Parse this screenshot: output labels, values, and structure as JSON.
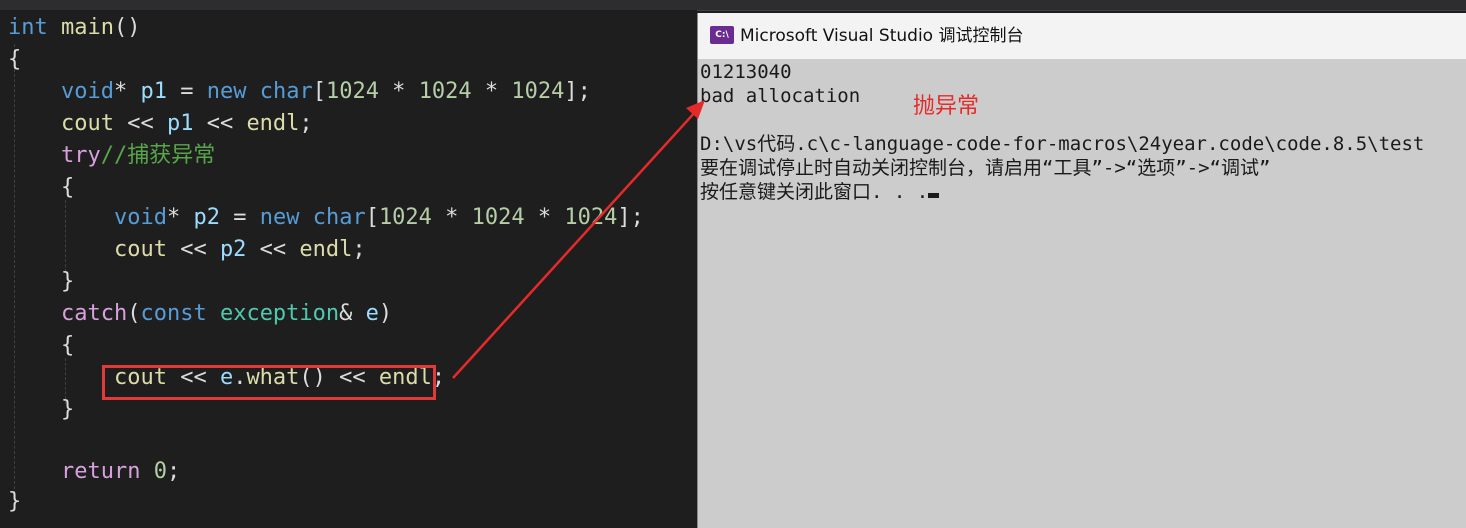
{
  "editor": {
    "lines": [
      [
        [
          "kw",
          "int"
        ],
        [
          "pl",
          " "
        ],
        [
          "fn",
          "main"
        ],
        [
          "pl",
          "()"
        ]
      ],
      [
        [
          "pl",
          "{"
        ]
      ],
      [
        [
          "pl",
          "    "
        ],
        [
          "kw",
          "void"
        ],
        [
          "pl",
          "* "
        ],
        [
          "var",
          "p1"
        ],
        [
          "pl",
          " = "
        ],
        [
          "kw",
          "new"
        ],
        [
          "pl",
          " "
        ],
        [
          "kw",
          "char"
        ],
        [
          "pl",
          "["
        ],
        [
          "num",
          "1024"
        ],
        [
          "pl",
          " * "
        ],
        [
          "num",
          "1024"
        ],
        [
          "pl",
          " * "
        ],
        [
          "num",
          "1024"
        ],
        [
          "pl",
          "];"
        ]
      ],
      [
        [
          "pl",
          "    "
        ],
        [
          "fn",
          "cout"
        ],
        [
          "pl",
          " << "
        ],
        [
          "var",
          "p1"
        ],
        [
          "pl",
          " << "
        ],
        [
          "fn",
          "endl"
        ],
        [
          "pl",
          ";"
        ]
      ],
      [
        [
          "pl",
          "    "
        ],
        [
          "ctl",
          "try"
        ],
        [
          "cm",
          "//捕获异常"
        ]
      ],
      [
        [
          "pl",
          "    {"
        ]
      ],
      [
        [
          "pl",
          "        "
        ],
        [
          "kw",
          "void"
        ],
        [
          "pl",
          "* "
        ],
        [
          "var",
          "p2"
        ],
        [
          "pl",
          " = "
        ],
        [
          "kw",
          "new"
        ],
        [
          "pl",
          " "
        ],
        [
          "kw",
          "char"
        ],
        [
          "pl",
          "["
        ],
        [
          "num",
          "1024"
        ],
        [
          "pl",
          " * "
        ],
        [
          "num",
          "1024"
        ],
        [
          "pl",
          " * "
        ],
        [
          "num",
          "1024"
        ],
        [
          "pl",
          "];"
        ]
      ],
      [
        [
          "pl",
          "        "
        ],
        [
          "fn",
          "cout"
        ],
        [
          "pl",
          " << "
        ],
        [
          "var",
          "p2"
        ],
        [
          "pl",
          " << "
        ],
        [
          "fn",
          "endl"
        ],
        [
          "pl",
          ";"
        ]
      ],
      [
        [
          "pl",
          "    }"
        ]
      ],
      [
        [
          "pl",
          "    "
        ],
        [
          "ctl",
          "catch"
        ],
        [
          "pl",
          "("
        ],
        [
          "kw",
          "const"
        ],
        [
          "pl",
          " "
        ],
        [
          "ty",
          "exception"
        ],
        [
          "pl",
          "& "
        ],
        [
          "var",
          "e"
        ],
        [
          "pl",
          ")"
        ]
      ],
      [
        [
          "pl",
          "    {"
        ]
      ],
      [
        [
          "pl",
          "        "
        ],
        [
          "fn",
          "cout"
        ],
        [
          "pl",
          " << "
        ],
        [
          "var",
          "e"
        ],
        [
          "pl",
          "."
        ],
        [
          "fn",
          "what"
        ],
        [
          "pl",
          "() << "
        ],
        [
          "fn",
          "endl"
        ],
        [
          "pl",
          ";"
        ]
      ],
      [
        [
          "pl",
          "    }"
        ]
      ],
      [
        [
          "pl",
          ""
        ]
      ],
      [
        [
          "pl",
          "    "
        ],
        [
          "ctl",
          "return"
        ],
        [
          "pl",
          " "
        ],
        [
          "num",
          "0"
        ],
        [
          "pl",
          ";"
        ]
      ],
      [
        [
          "pl",
          "}"
        ]
      ]
    ]
  },
  "console": {
    "title": "Microsoft Visual Studio 调试控制台",
    "icon": "console-app-icon",
    "icon_label": "C:\\",
    "output": [
      "01213040",
      "bad allocation",
      "",
      "D:\\vs代码.c\\c-language-code-for-macros\\24year.code\\code.8.5\\test",
      "要在调试停止时自动关闭控制台，请启用“工具”->“选项”->“调试”",
      "按任意键关闭此窗口. . ."
    ]
  },
  "annotation": {
    "text": "抛异常",
    "color": "#e52a2a"
  }
}
